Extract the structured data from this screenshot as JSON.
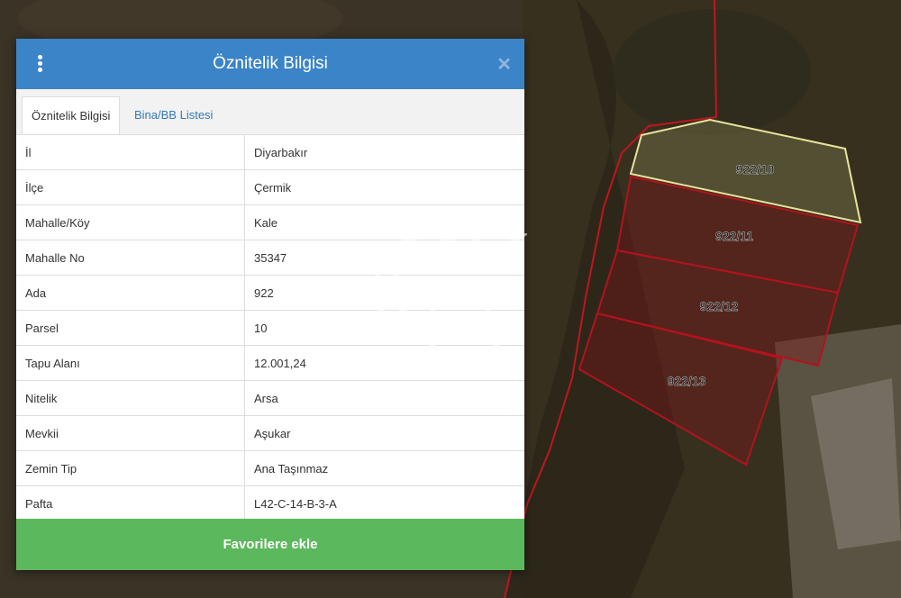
{
  "header": {
    "title": "Öznitelik Bilgisi"
  },
  "tabs": [
    {
      "label": "Öznitelik Bilgisi",
      "active": true
    },
    {
      "label": "Bina/BB Listesi",
      "active": false
    }
  ],
  "rows": [
    {
      "key": "İl",
      "value": "Diyarbakır"
    },
    {
      "key": "İlçe",
      "value": "Çermik"
    },
    {
      "key": "Mahalle/Köy",
      "value": "Kale"
    },
    {
      "key": "Mahalle No",
      "value": "35347"
    },
    {
      "key": "Ada",
      "value": "922"
    },
    {
      "key": "Parsel",
      "value": "10"
    },
    {
      "key": "Tapu Alanı",
      "value": "12.001,24"
    },
    {
      "key": "Nitelik",
      "value": "Arsa"
    },
    {
      "key": "Mevkii",
      "value": "Aşukar"
    },
    {
      "key": "Zemin Tip",
      "value": "Ana Taşınmaz"
    },
    {
      "key": "Pafta",
      "value": "L42-C-14-B-3-A"
    }
  ],
  "button": {
    "favorite_label": "Favorilere ekle"
  },
  "parcels": [
    {
      "label": "922/10",
      "selected": true
    },
    {
      "label": "922/11",
      "selected": false
    },
    {
      "label": "922/12",
      "selected": false
    },
    {
      "label": "922/13",
      "selected": false
    }
  ],
  "colors": {
    "header": "#3b84c8",
    "button": "#5cb85c",
    "selected_parcel": "#e8e39a",
    "parcel": "#b3121f"
  }
}
